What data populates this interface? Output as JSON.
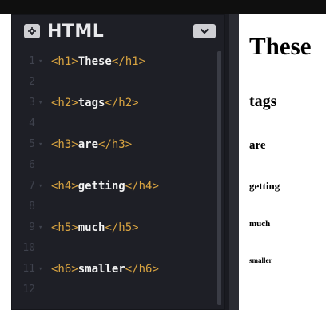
{
  "editor": {
    "title": "HTML",
    "settings_icon": "gear-icon",
    "collapse_icon": "chevron-down-icon",
    "lines": [
      {
        "num": "1",
        "open": "<h1>",
        "text": "These",
        "close": "</h1>",
        "fold": true
      },
      {
        "num": "2",
        "open": "",
        "text": "",
        "close": "",
        "fold": false
      },
      {
        "num": "3",
        "open": "<h2>",
        "text": "tags",
        "close": "</h2>",
        "fold": true
      },
      {
        "num": "4",
        "open": "",
        "text": "",
        "close": "",
        "fold": false
      },
      {
        "num": "5",
        "open": "<h3>",
        "text": "are",
        "close": "</h3>",
        "fold": true
      },
      {
        "num": "6",
        "open": "",
        "text": "",
        "close": "",
        "fold": false
      },
      {
        "num": "7",
        "open": "<h4>",
        "text": "getting",
        "close": "</h4>",
        "fold": true
      },
      {
        "num": "8",
        "open": "",
        "text": "",
        "close": "",
        "fold": false
      },
      {
        "num": "9",
        "open": "<h5>",
        "text": "much",
        "close": "</h5>",
        "fold": true
      },
      {
        "num": "10",
        "open": "",
        "text": "",
        "close": "",
        "fold": false
      },
      {
        "num": "11",
        "open": "<h6>",
        "text": "smaller",
        "close": "</h6>",
        "fold": true
      },
      {
        "num": "12",
        "open": "",
        "text": "",
        "close": "",
        "fold": false
      }
    ]
  },
  "preview": {
    "h1": "These",
    "h2": "tags",
    "h3": "are",
    "h4": "getting",
    "h5": "much",
    "h6": "smaller"
  },
  "colors": {
    "editor_bg": "#1e1f26",
    "tag": "#d9a441",
    "text": "#f2f2f2",
    "line_number": "#3f424d"
  }
}
